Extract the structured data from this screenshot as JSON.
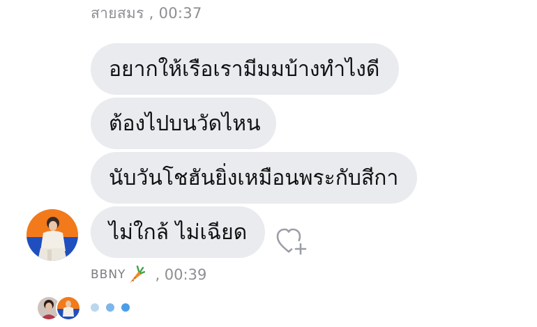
{
  "top_meta": {
    "sender": "สายสมร",
    "time": " , 00:37"
  },
  "messages": [
    {
      "text": "อยากให้เรือเรามีมมบ้างทำไงดี"
    },
    {
      "text": "ต้องไปบนวัดไหน"
    },
    {
      "text": "นับวันโชฮันยิ่งเหมือนพระกับสีกา"
    },
    {
      "text": "ไม่ใกล้ ไม่เฉียด"
    }
  ],
  "bottom_meta": {
    "sender": "BBNY",
    "emoji_icon": "carrot-icon",
    "time": " , 00:39"
  },
  "icons": {
    "reaction": "heart-plus-icon",
    "avatar": "user-avatar",
    "typing": "typing-indicator"
  },
  "colors": {
    "bubble": "#e9ebef",
    "meta_text": "#8e8e93",
    "heart_outline": "#9a9ea6",
    "typing_dot_light": "#bcd6ee",
    "typing_dot_dark": "#4a9de8",
    "avatar_orange": "#f27a1a",
    "avatar_blue": "#1f4fbf"
  }
}
